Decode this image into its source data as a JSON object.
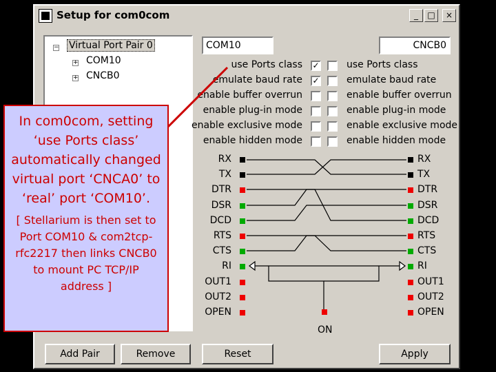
{
  "window": {
    "title": "Setup for com0com",
    "buttons": {
      "minimize": "_",
      "maximize": "□",
      "close": "×"
    }
  },
  "tree": {
    "root_label": "Virtual Port Pair 0",
    "children": [
      "COM10",
      "CNCB0"
    ],
    "root_expander": "−",
    "child_expander": "+"
  },
  "left_port": {
    "name": "COM10"
  },
  "right_port": {
    "name": "CNCB0"
  },
  "options": [
    {
      "label": "use Ports class",
      "left_checked": true,
      "right_checked": false
    },
    {
      "label": "emulate baud rate",
      "left_checked": true,
      "right_checked": false
    },
    {
      "label": "enable buffer overrun",
      "left_checked": false,
      "right_checked": false
    },
    {
      "label": "enable plug-in mode",
      "left_checked": false,
      "right_checked": false
    },
    {
      "label": "enable exclusive mode",
      "left_checked": false,
      "right_checked": false
    },
    {
      "label": "enable hidden mode",
      "left_checked": false,
      "right_checked": false
    }
  ],
  "check_mark": "✓",
  "signals": [
    {
      "name": "RX",
      "color": "#000000"
    },
    {
      "name": "TX",
      "color": "#000000"
    },
    {
      "name": "DTR",
      "color": "#ee0000"
    },
    {
      "name": "DSR",
      "color": "#00aa00"
    },
    {
      "name": "DCD",
      "color": "#00aa00"
    },
    {
      "name": "RTS",
      "color": "#ee0000"
    },
    {
      "name": "CTS",
      "color": "#00aa00"
    },
    {
      "name": "RI",
      "color": "#00aa00"
    },
    {
      "name": "OUT1",
      "color": "#ee0000"
    },
    {
      "name": "OUT2",
      "color": "#ee0000"
    },
    {
      "name": "OPEN",
      "color": "#ee0000"
    }
  ],
  "on_label": "ON",
  "on_color": "#ee0000",
  "buttons": {
    "add_pair": "Add Pair",
    "remove": "Remove",
    "reset": "Reset",
    "apply": "Apply"
  },
  "callout": {
    "main_text": "In com0com, setting ‘use Ports class’ automatically changed virtual port ‘CNCA0’ to ‘real’ port ‘COM10’.",
    "note_text": "[ Stellarium is then set to Port COM10 & com2tcp-rfc2217 then links CNCB0 to mount PC TCP/IP address ]",
    "border_color": "#cc0000",
    "fill_color": "#ccccff"
  }
}
